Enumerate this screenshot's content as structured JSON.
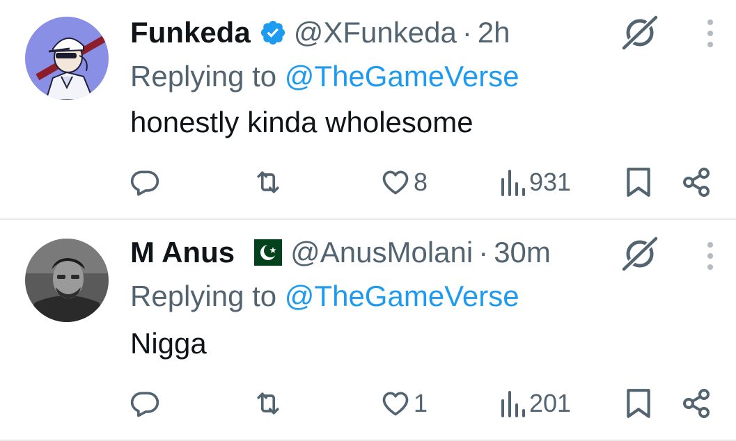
{
  "replies": [
    {
      "name": "Funkeda",
      "handle": "@XFunkeda",
      "separator": "·",
      "time": "2h",
      "replying_prefix": "Replying to",
      "replying_to": "@TheGameVerse",
      "text": "honestly kinda wholesome",
      "like_count": "8",
      "view_count": "931",
      "badge": "verified-badge-icon"
    },
    {
      "name": "M Anus",
      "handle": "@AnusMolani",
      "separator": "·",
      "time": "30m",
      "replying_prefix": "Replying to",
      "replying_to": "@TheGameVerse",
      "text": "Nigga",
      "like_count": "1",
      "view_count": "201",
      "badge": "pakistan-flag-icon"
    }
  ],
  "colors": {
    "text": "#0f1419",
    "secondary": "#536471",
    "accent": "#1d9bf0",
    "divider": "#e7e9ea"
  }
}
